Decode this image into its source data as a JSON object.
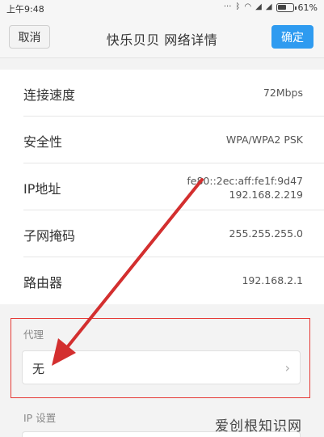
{
  "status_bar": {
    "time": "上午9:48",
    "battery_percent": "61%",
    "battery_level": 0.61
  },
  "header": {
    "cancel_label": "取消",
    "title": "快乐贝贝  网络详情",
    "confirm_label": "确定"
  },
  "details": [
    {
      "key": "连接速度",
      "value": "72Mbps"
    },
    {
      "key": "安全性",
      "value": "WPA/WPA2 PSK"
    },
    {
      "key": "IP地址",
      "value_lines": [
        "fe80::2ec:aff:fe1f:9d47",
        "192.168.2.219"
      ]
    },
    {
      "key": "子网掩码",
      "value": "255.255.255.0"
    },
    {
      "key": "路由器",
      "value": "192.168.2.1"
    }
  ],
  "proxy": {
    "label": "代理",
    "value": "无"
  },
  "ip_settings": {
    "label": "IP 设置"
  },
  "watermark": "爱创根知识网",
  "colors": {
    "accent": "#2f9bf0",
    "annotation": "#e53935"
  }
}
